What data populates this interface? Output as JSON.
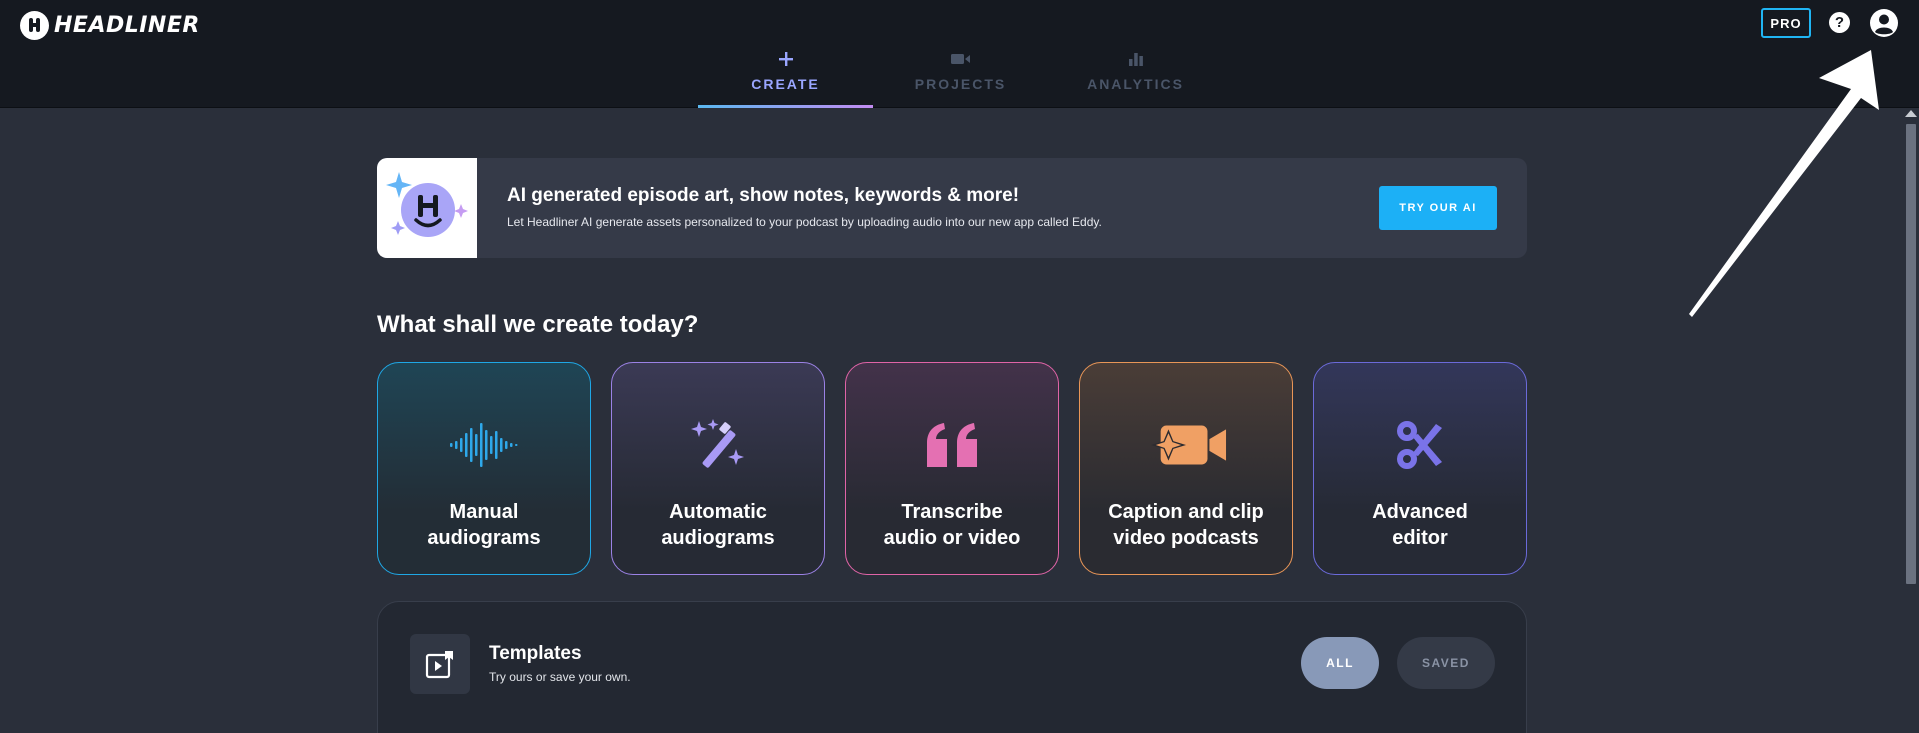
{
  "header": {
    "logo_text": "HEADLINER",
    "pro_label": "PRO",
    "help_glyph": "?",
    "nav": [
      {
        "label": "CREATE",
        "icon": "plus-icon",
        "active": true
      },
      {
        "label": "PROJECTS",
        "icon": "video-camera-icon",
        "active": false
      },
      {
        "label": "ANALYTICS",
        "icon": "bar-chart-icon",
        "active": false
      }
    ]
  },
  "banner": {
    "title": "AI generated episode art, show notes, keywords & more!",
    "subtitle": "Let Headliner AI generate assets personalized to your podcast by uploading audio into our new app called Eddy.",
    "button_label": "TRY OUR AI"
  },
  "create": {
    "heading": "What shall we create today?",
    "cards": [
      {
        "title": "Manual\naudiograms",
        "icon": "waveform-icon",
        "color": "#2ea8ea"
      },
      {
        "title": "Automatic\naudiograms",
        "icon": "magic-wand-icon",
        "color": "#a99af5"
      },
      {
        "title": "Transcribe\naudio or video",
        "icon": "quote-icon",
        "color": "#e470b2"
      },
      {
        "title": "Caption and clip\nvideo podcasts",
        "icon": "sparkle-video-icon",
        "color": "#f0a064"
      },
      {
        "title": "Advanced\neditor",
        "icon": "scissors-icon",
        "color": "#7a73e8"
      }
    ]
  },
  "templates": {
    "title": "Templates",
    "subtitle": "Try ours or save your own.",
    "filters": [
      {
        "label": "ALL",
        "active": true
      },
      {
        "label": "SAVED",
        "active": false
      }
    ]
  },
  "colors": {
    "accent": "#1cb0f6",
    "background": "#2a2f3a",
    "header": "#151920"
  }
}
